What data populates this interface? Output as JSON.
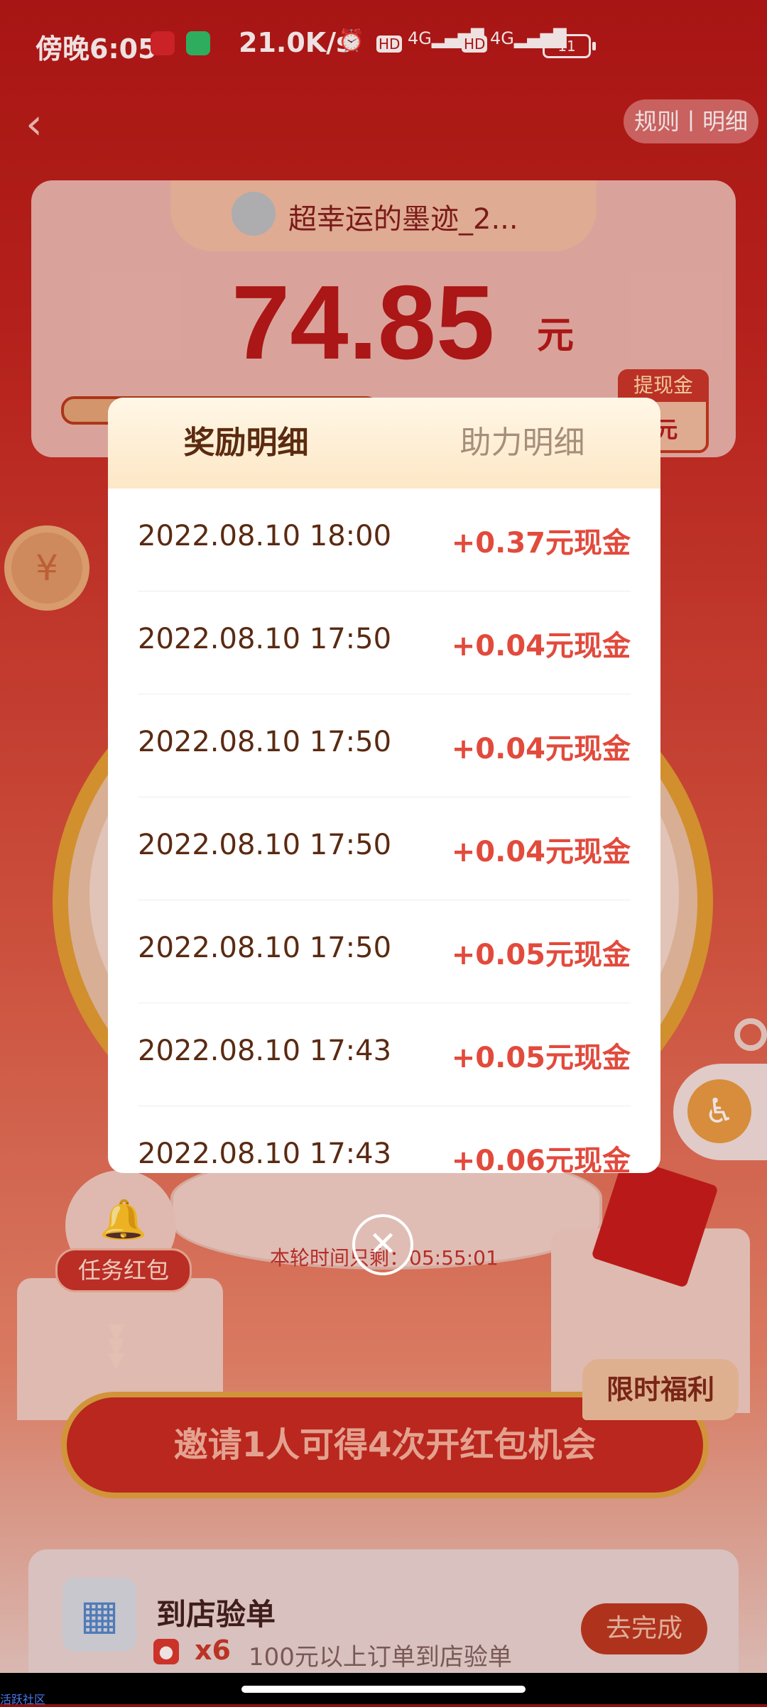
{
  "status_bar": {
    "time": "傍晚6:05",
    "network_speed": "21.0K/s",
    "battery": "11",
    "icons": [
      "app-badge-red",
      "app-badge-green",
      "alarm-icon",
      "hd-icon",
      "signal-4g-icon",
      "hd-icon",
      "signal-4g-icon",
      "battery-icon"
    ]
  },
  "header": {
    "back_icon": "‹",
    "rules_label": "规则丨明细"
  },
  "top_card": {
    "username": "超幸运的墨迹_2...",
    "amount": "74.85",
    "amount_unit": "元",
    "withdraw_label": "提现金",
    "withdraw_value": "0元"
  },
  "modal": {
    "tabs": [
      {
        "label": "奖励明细",
        "active": true
      },
      {
        "label": "助力明细",
        "active": false
      }
    ],
    "rows": [
      {
        "date": "2022.08.10 18:00",
        "reward": "+0.37元现金"
      },
      {
        "date": "2022.08.10 17:50",
        "reward": "+0.04元现金"
      },
      {
        "date": "2022.08.10 17:50",
        "reward": "+0.04元现金"
      },
      {
        "date": "2022.08.10 17:50",
        "reward": "+0.04元现金"
      },
      {
        "date": "2022.08.10 17:50",
        "reward": "+0.05元现金"
      },
      {
        "date": "2022.08.10 17:43",
        "reward": "+0.05元现金"
      },
      {
        "date": "2022.08.10 17:43",
        "reward": "+0.06元现金"
      }
    ],
    "close_icon": "✕"
  },
  "background": {
    "task_red_packet_label": "任务红包",
    "timer_text": "本轮时间只剩：05:55:01",
    "invite_text": "邀请1人可得4次开红包机会",
    "limited_label": "限时福利"
  },
  "task": {
    "title": "到店验单",
    "multiplier": "x6",
    "description": "100元以上订单到店验单",
    "action": "去完成"
  },
  "watermark": "活跃社区",
  "colors": {
    "accent_red": "#e24a3c",
    "brand_red": "#b41818",
    "tab_text": "#5b2b10"
  }
}
